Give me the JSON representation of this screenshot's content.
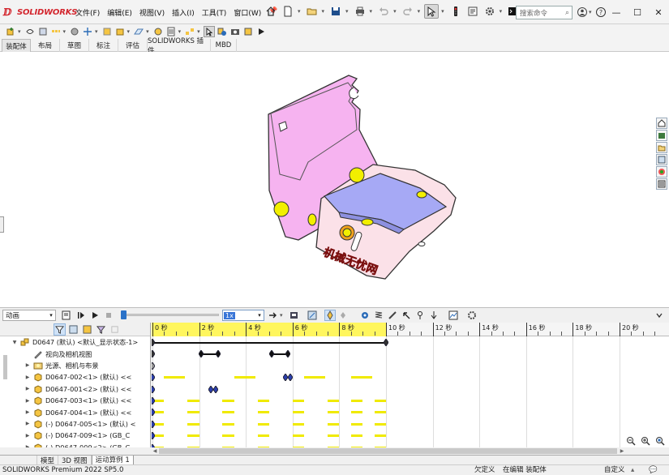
{
  "app": {
    "logo_text": "SOLIDWORKS",
    "menu": [
      "文件(F)",
      "编辑(E)",
      "视图(V)",
      "插入(I)",
      "工具(T)",
      "窗口(W)"
    ],
    "search_placeholder": "搜索命令",
    "doc_label": "D"
  },
  "command_tabs": [
    "装配体",
    "布局",
    "草图",
    "标注",
    "评估",
    "SOLIDWORKS 插件",
    "MBD"
  ],
  "motion": {
    "study_type": "动画",
    "speed_value": "1x",
    "ruler_labels": [
      "0 秒",
      "2 秒",
      "4 秒",
      "6 秒",
      "8 秒",
      "10 秒",
      "12 秒",
      "14 秒",
      "16 秒",
      "18 秒",
      "20 秒"
    ],
    "tree": [
      {
        "label": "D0647 (默认) <默认_显示状态-1>",
        "icon": "assembly-icon",
        "indent": 0,
        "expand": "▼"
      },
      {
        "label": "视向及相机视图",
        "icon": "camera-icon",
        "indent": 1,
        "expand": ""
      },
      {
        "label": "光源、相机与布景",
        "icon": "lights-folder-icon",
        "indent": 1,
        "expand": "▶"
      },
      {
        "label": "D0647-002<1> (默认) <<",
        "icon": "part-icon",
        "indent": 1,
        "expand": "▶"
      },
      {
        "label": "D0647-001<2> (默认) <<",
        "icon": "part-icon",
        "indent": 1,
        "expand": "▶"
      },
      {
        "label": "D0647-003<1> (默认) <<",
        "icon": "part-icon",
        "indent": 1,
        "expand": "▶"
      },
      {
        "label": "D0647-004<1> (默认) <<",
        "icon": "part-icon",
        "indent": 1,
        "expand": "▶"
      },
      {
        "label": "(-) D0647-005<1> (默认) <",
        "icon": "part-icon",
        "indent": 1,
        "expand": "▶"
      },
      {
        "label": "(-) D0647-009<1> (GB_C",
        "icon": "part-icon",
        "indent": 1,
        "expand": "▶"
      },
      {
        "label": "(-) D0647-009<2> (GB_C",
        "icon": "part-icon",
        "indent": 1,
        "expand": "▶"
      }
    ],
    "keyframe_rows": [
      {
        "keys": [
          0,
          10
        ],
        "spans": [
          [
            0,
            10
          ]
        ],
        "bars": []
      },
      {
        "keys": [
          0
        ],
        "spans": [
          [
            2.1,
            2.8
          ],
          [
            5.1,
            5.8
          ]
        ],
        "bars": []
      },
      {
        "keys": [
          0
        ],
        "spans": [],
        "bars": []
      },
      {
        "keys": [
          0,
          5.7,
          5.9
        ],
        "spans": [],
        "bars": [
          [
            0.5,
            1.4
          ],
          [
            3.5,
            4.4
          ],
          [
            6.5,
            7.4
          ],
          [
            8.5,
            9.4
          ]
        ]
      },
      {
        "keys": [
          0,
          2.5,
          2.7
        ],
        "spans": [],
        "bars": []
      },
      {
        "keys": [
          0
        ],
        "spans": [],
        "bars": [
          [
            0.1,
            0.5
          ],
          [
            1.5,
            2.0
          ],
          [
            3.0,
            3.5
          ],
          [
            4.5,
            5.0
          ],
          [
            6.0,
            6.5
          ],
          [
            7.5,
            8.0
          ],
          [
            8.5,
            9.0
          ],
          [
            9.5,
            10.0
          ]
        ]
      },
      {
        "keys": [
          0
        ],
        "spans": [],
        "bars": [
          [
            0.1,
            0.5
          ],
          [
            1.5,
            2.0
          ],
          [
            3.0,
            3.5
          ],
          [
            4.5,
            5.0
          ],
          [
            6.0,
            6.5
          ],
          [
            7.5,
            8.0
          ],
          [
            8.5,
            9.0
          ],
          [
            9.5,
            10.0
          ]
        ]
      },
      {
        "keys": [
          0
        ],
        "spans": [],
        "bars": [
          [
            0.1,
            0.5
          ],
          [
            1.5,
            2.0
          ],
          [
            3.0,
            3.5
          ],
          [
            4.5,
            5.0
          ],
          [
            6.0,
            6.5
          ],
          [
            7.5,
            8.0
          ],
          [
            8.5,
            9.0
          ],
          [
            9.5,
            10.0
          ]
        ]
      },
      {
        "keys": [
          0
        ],
        "spans": [],
        "bars": [
          [
            0.1,
            0.5
          ],
          [
            1.5,
            2.0
          ],
          [
            3.0,
            3.5
          ],
          [
            4.5,
            5.0
          ],
          [
            6.0,
            6.5
          ],
          [
            7.5,
            8.0
          ],
          [
            8.5,
            9.0
          ],
          [
            9.5,
            10.0
          ]
        ]
      },
      {
        "keys": [
          0
        ],
        "spans": [],
        "bars": [
          [
            0.1,
            0.5
          ],
          [
            1.5,
            2.0
          ],
          [
            3.0,
            3.5
          ],
          [
            4.5,
            5.0
          ],
          [
            6.0,
            6.5
          ],
          [
            7.5,
            8.0
          ],
          [
            8.5,
            9.0
          ],
          [
            9.5,
            10.0
          ]
        ]
      }
    ],
    "duration_seconds": 10
  },
  "bottom_tabs": [
    "模型",
    "3D 视图",
    "运动算例 1"
  ],
  "statusbar": {
    "left": "SOLIDWORKS Premium 2022 SP5.0",
    "underdefined": "欠定义",
    "editing": "在编辑 装配体",
    "custom": "自定义"
  },
  "model_text": "机械无忧网",
  "colors": {
    "part_pink": "#f6b3f0",
    "part_blue": "#a6a9f5",
    "yellow": "#f2ef00",
    "brand_red": "#d3262e"
  }
}
